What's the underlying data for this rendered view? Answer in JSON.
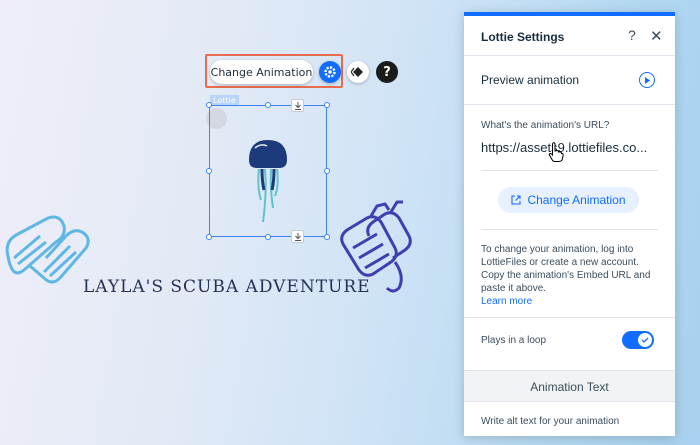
{
  "toolbar": {
    "change_animation_label": "Change Animation",
    "settings_icon": "gear-icon",
    "animation_icon": "animation-icon",
    "help_symbol": "?"
  },
  "selection": {
    "tag_label": "Lottie",
    "download_icon": "download-icon"
  },
  "canvas": {
    "title": "LAYLA'S SCUBA ADVENTURE",
    "decor": [
      "jellyfish-animation",
      "fins-illustration",
      "scuba-tank-illustration"
    ]
  },
  "panel": {
    "title": "Lottie Settings",
    "help_symbol": "?",
    "close_symbol": "✕",
    "preview_label": "Preview animation",
    "url_label": "What's the animation's URL?",
    "url_value": "https://assets9.lottiefiles.co...",
    "change_button_label": "Change Animation",
    "info_text": "To change your animation, log into LottieFiles or create a new account. Copy the animation's Embed URL and paste it above.",
    "learn_more": "Learn more",
    "loop_label": "Plays in a loop",
    "loop_enabled": true,
    "alt_section_title": "Animation Text",
    "alt_description": "Write alt text for your animation"
  },
  "colors": {
    "accent": "#116dff",
    "highlight": "#ea6b4d",
    "title_text": "#253057",
    "jellyfish": "#1d3b7a",
    "fins": "#5fb7e5",
    "tank": "#3f3fb0"
  }
}
